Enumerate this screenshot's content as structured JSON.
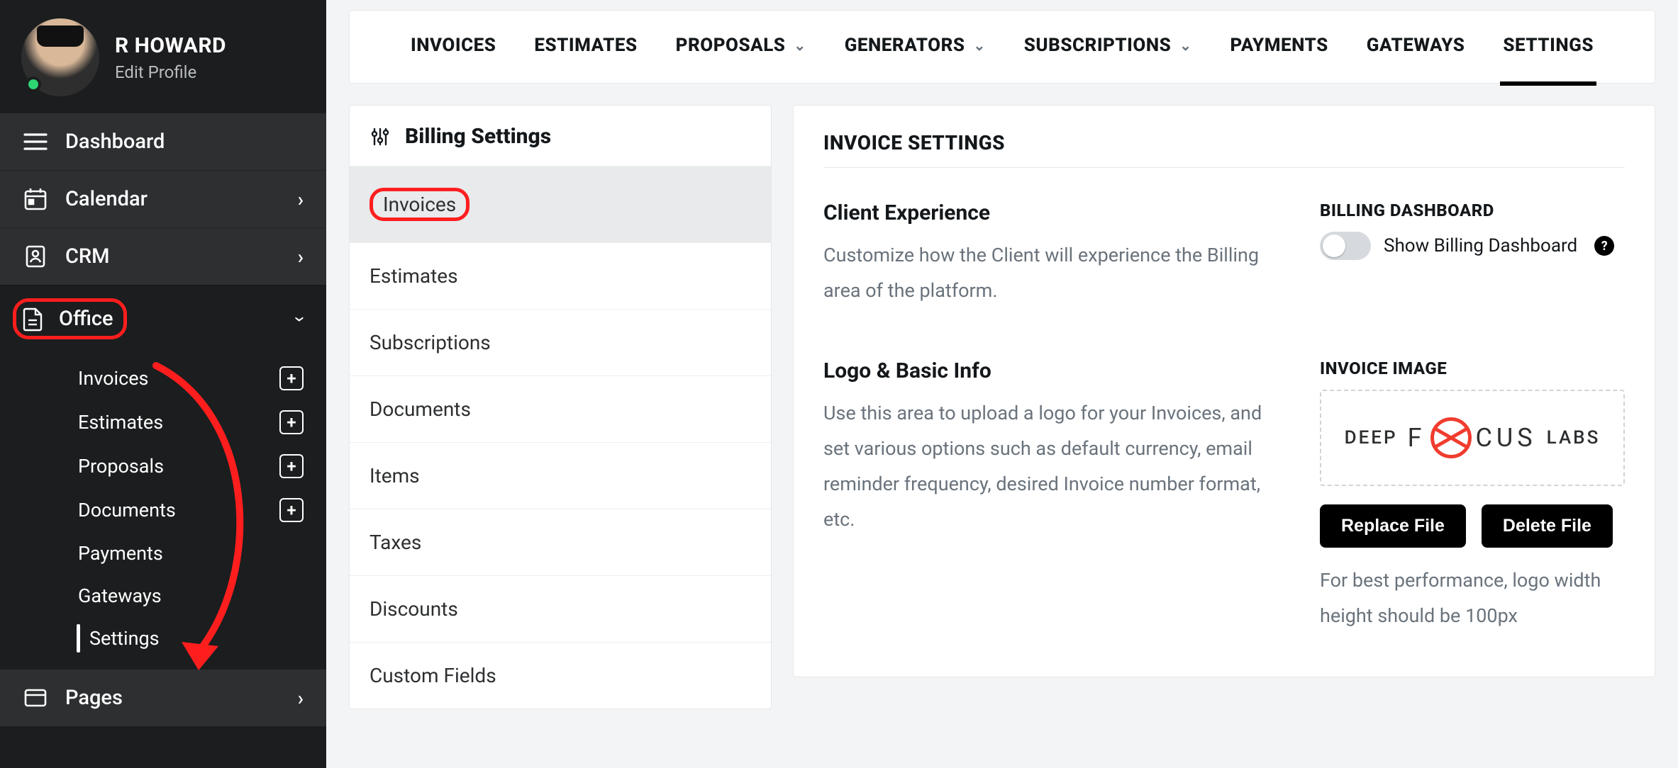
{
  "profile": {
    "name": "R HOWARD",
    "edit": "Edit Profile"
  },
  "sidebar": {
    "dashboard": "Dashboard",
    "calendar": "Calendar",
    "crm": "CRM",
    "office": "Office",
    "pages": "Pages",
    "office_sub": {
      "invoices": "Invoices",
      "estimates": "Estimates",
      "proposals": "Proposals",
      "documents": "Documents",
      "payments": "Payments",
      "gateways": "Gateways",
      "settings": "Settings"
    }
  },
  "tabs": {
    "invoices": "INVOICES",
    "estimates": "ESTIMATES",
    "proposals": "PROPOSALS",
    "generators": "GENERATORS",
    "subscriptions": "SUBSCRIPTIONS",
    "payments": "PAYMENTS",
    "gateways": "GATEWAYS",
    "settings": "SETTINGS"
  },
  "settings_col": {
    "title": "Billing Settings",
    "items": {
      "invoices": "Invoices",
      "estimates": "Estimates",
      "subscriptions": "Subscriptions",
      "documents": "Documents",
      "items": "Items",
      "taxes": "Taxes",
      "discounts": "Discounts",
      "custom_fields": "Custom Fields"
    }
  },
  "panel": {
    "heading": "INVOICE SETTINGS",
    "client_exp_title": "Client Experience",
    "client_exp_text": "Customize how the Client will experience the Billing area of the platform.",
    "billing_dash_heading": "BILLING DASHBOARD",
    "billing_dash_toggle_label": "Show Billing Dashboard",
    "logo_title": "Logo & Basic Info",
    "logo_text": "Use this area to upload a logo for your Invoices, and set various options such as default currency, email reminder frequency, desired Invoice number format, etc.",
    "invoice_image_heading": "INVOICE IMAGE",
    "logo_parts": {
      "left": "DEEP",
      "mid_left": "F",
      "mid_right": "CUS",
      "right": "LABS"
    },
    "replace_btn": "Replace File",
    "delete_btn": "Delete File",
    "hint": "For best performance, logo width height should be 100px"
  }
}
